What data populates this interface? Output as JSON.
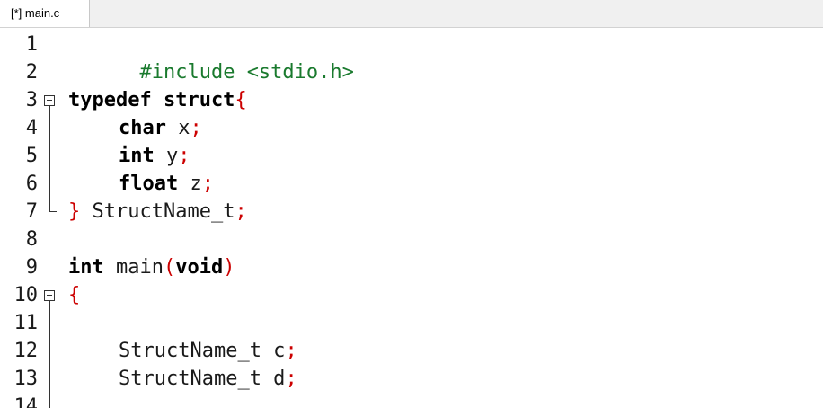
{
  "tab": {
    "label": "[*] main.c"
  },
  "gutter": {
    "line_numbers": [
      "1",
      "2",
      "3",
      "4",
      "5",
      "6",
      "7",
      "8",
      "9",
      "10",
      "11",
      "12",
      "13",
      "14"
    ]
  },
  "code": {
    "line1": {
      "text": "#include <stdio.h>"
    },
    "line3": {
      "kw": "typedef struct",
      "brace": "{"
    },
    "line4": {
      "kw": "char",
      "rest": " x",
      "semi": ";"
    },
    "line5": {
      "kw": "int",
      "rest": " y",
      "semi": ";"
    },
    "line6": {
      "kw": "float",
      "rest": " z",
      "semi": ";"
    },
    "line7": {
      "brace": "}",
      "rest": " StructName_t",
      "semi": ";"
    },
    "line9": {
      "kw1": "int",
      "rest": " main",
      "p1": "(",
      "kw2": "void",
      "p2": ")"
    },
    "line10": {
      "brace": "{"
    },
    "line12": {
      "rest": "StructName_t c",
      "semi": ";"
    },
    "line13": {
      "rest": "StructName_t d",
      "semi": ";"
    }
  },
  "colors": {
    "preprocessor": "#1a7a2e",
    "brace": "#cc0000"
  }
}
